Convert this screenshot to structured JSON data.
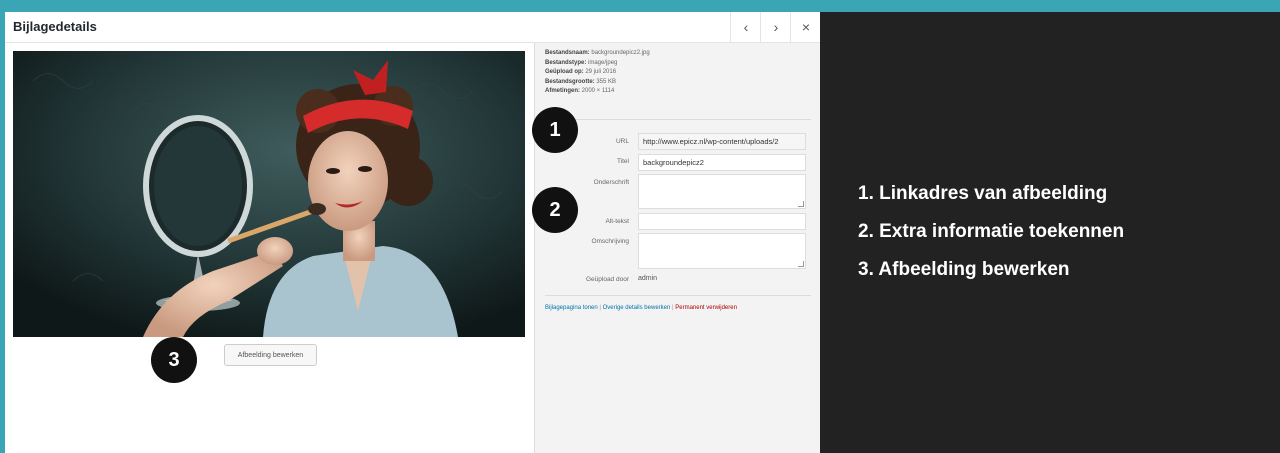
{
  "dialog": {
    "title": "Bijlagedetails",
    "nav": {
      "prev": "‹",
      "next": "›",
      "close": "×"
    },
    "edit_button": "Afbeelding bewerken"
  },
  "meta": {
    "filename_label": "Bestandsnaam:",
    "filename": "backgroundepicz2.jpg",
    "type_label": "Bestandstype:",
    "type": "image/jpeg",
    "uploaded_label": "Geüpload op:",
    "uploaded": "29 juli 2016",
    "size_label": "Bestandsgrootte:",
    "size": "355 KB",
    "dims_label": "Afmetingen:",
    "dims": "2000 × 1114"
  },
  "fields": {
    "url_label": "URL",
    "url_value": "http://www.epicz.nl/wp-content/uploads/2",
    "title_label": "Titel",
    "title_value": "backgroundepicz2",
    "caption_label": "Onderschrift",
    "caption_value": "",
    "alt_label": "Alt-tekst",
    "alt_value": "",
    "desc_label": "Omschrijving",
    "desc_value": "",
    "uploader_label": "Geüpload door",
    "uploader_value": "admin"
  },
  "links": {
    "view": "Bijlagepagina tonen",
    "sep": "|",
    "edit": "Overige details bewerken",
    "delete": "Permanent verwijderen"
  },
  "markers": {
    "m1": "1",
    "m2": "2",
    "m3": "3"
  },
  "legend": {
    "item1": "1. Linkadres van afbeelding",
    "item2": "2. Extra informatie toekennen",
    "item3": "3. Afbeelding bewerken"
  },
  "colors": {
    "frame": "#3aa5b4",
    "panel": "#222222",
    "link": "#0073aa",
    "danger": "#aa0000"
  }
}
